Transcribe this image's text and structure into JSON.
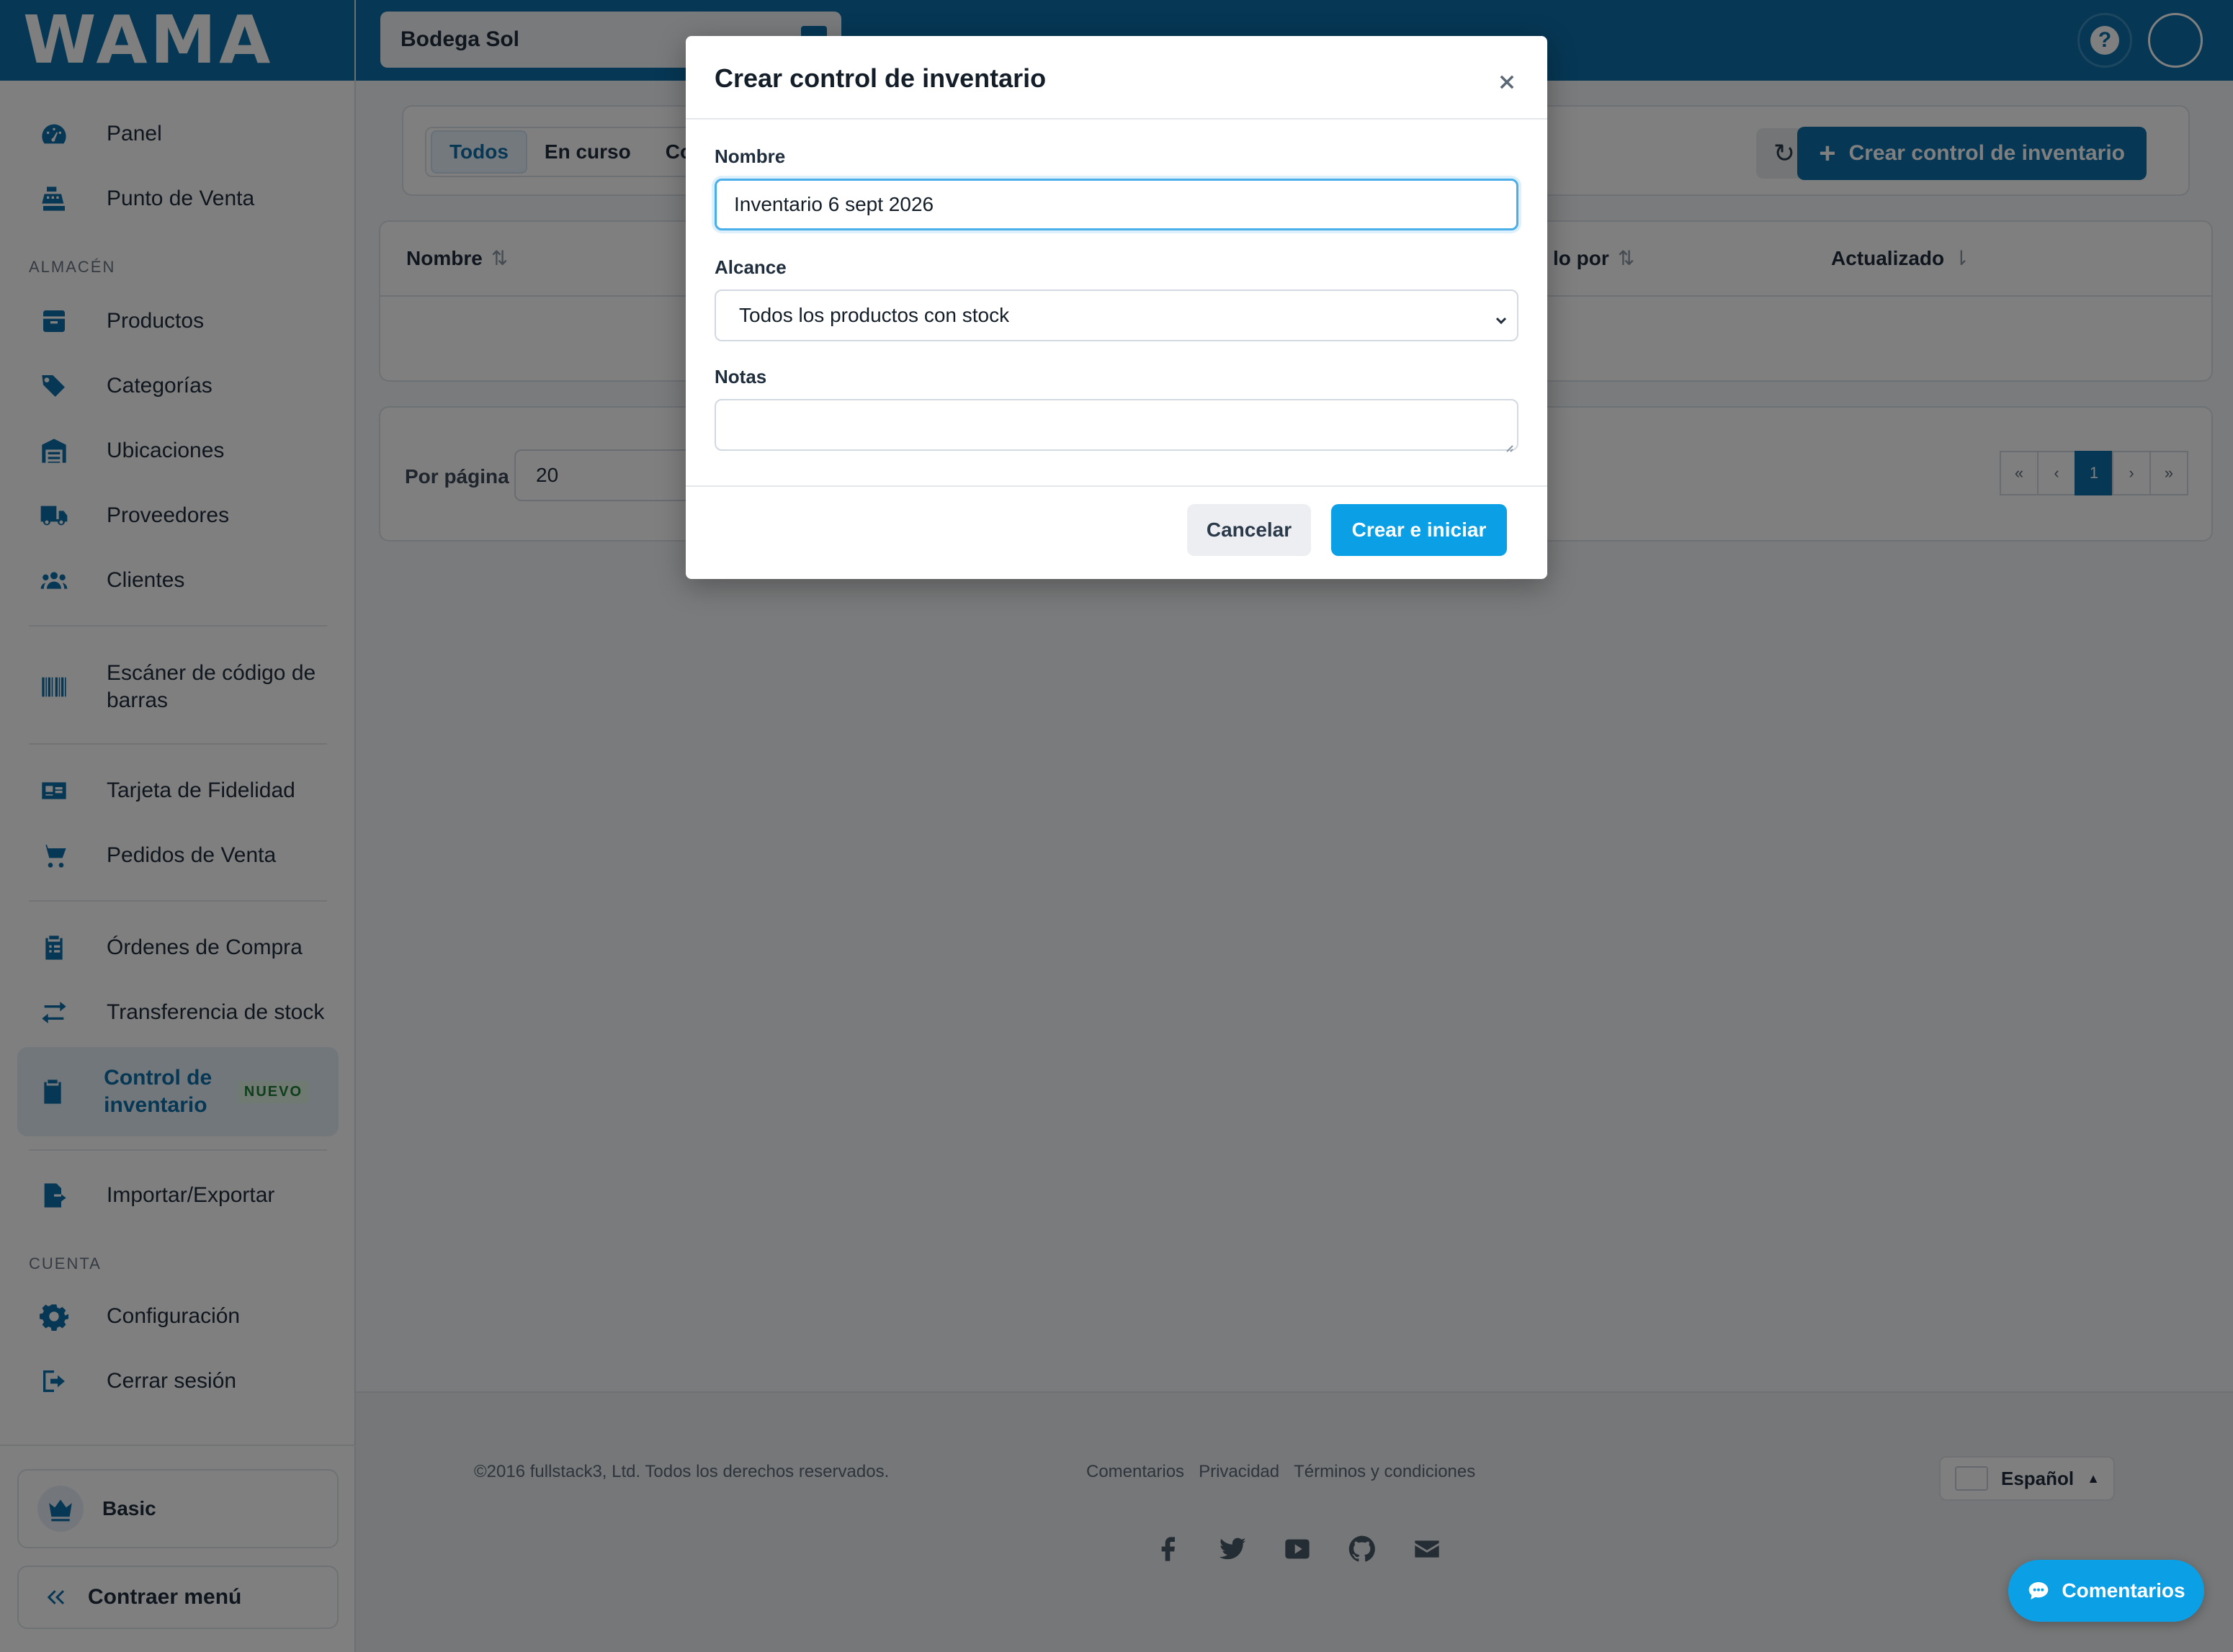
{
  "app": {
    "logo_text": "WAMA"
  },
  "topbar": {
    "store_name": "Bodega Sol",
    "help_label": "?"
  },
  "sidebar": {
    "panel": "Panel",
    "pos": "Punto de Venta",
    "section_warehouse": "ALMACÉN",
    "products": "Productos",
    "categories": "Categorías",
    "locations": "Ubicaciones",
    "suppliers": "Proveedores",
    "customers": "Clientes",
    "barcode_scanner": "Escáner de código de barras",
    "loyalty_card": "Tarjeta de Fidelidad",
    "sales_orders": "Pedidos de Venta",
    "purchase_orders": "Órdenes de Compra",
    "stock_transfer": "Transferencia de stock",
    "inventory_control": "Control de inventario",
    "new_badge": "NUEVO",
    "import_export": "Importar/Exportar",
    "section_account": "CUENTA",
    "settings": "Configuración",
    "logout": "Cerrar sesión",
    "plan": "Basic",
    "collapse": "Contraer menú"
  },
  "main": {
    "tabs": [
      "Todos",
      "En curso",
      "Con"
    ],
    "create_label": "Crear control de inventario",
    "refresh_icon": "↻",
    "table": {
      "columns": [
        "Nombre",
        "lo por",
        "Actualizado"
      ]
    },
    "pager": {
      "per_page_label": "Por página",
      "per_page_value": "20",
      "pages": [
        "«",
        "‹",
        "1",
        "›",
        "»"
      ]
    }
  },
  "footer": {
    "copyright": "©2016 fullstack3, Ltd. Todos los derechos reservados.",
    "links": [
      "Comentarios",
      "Privacidad",
      "Términos y condiciones"
    ],
    "language": "Español"
  },
  "feedback": {
    "label": "Comentarios"
  },
  "modal": {
    "title": "Crear control de inventario",
    "name_label": "Nombre",
    "name_value": "Inventario 6 sept 2026",
    "scope_label": "Alcance",
    "scope_value": "Todos los productos con stock",
    "notes_label": "Notas",
    "notes_value": "",
    "cancel_label": "Cancelar",
    "submit_label": "Crear e iniciar"
  },
  "colors": {
    "brand": "#0d6ea8",
    "accent": "#0ba0e6",
    "new_badge": "#1a7f37"
  }
}
